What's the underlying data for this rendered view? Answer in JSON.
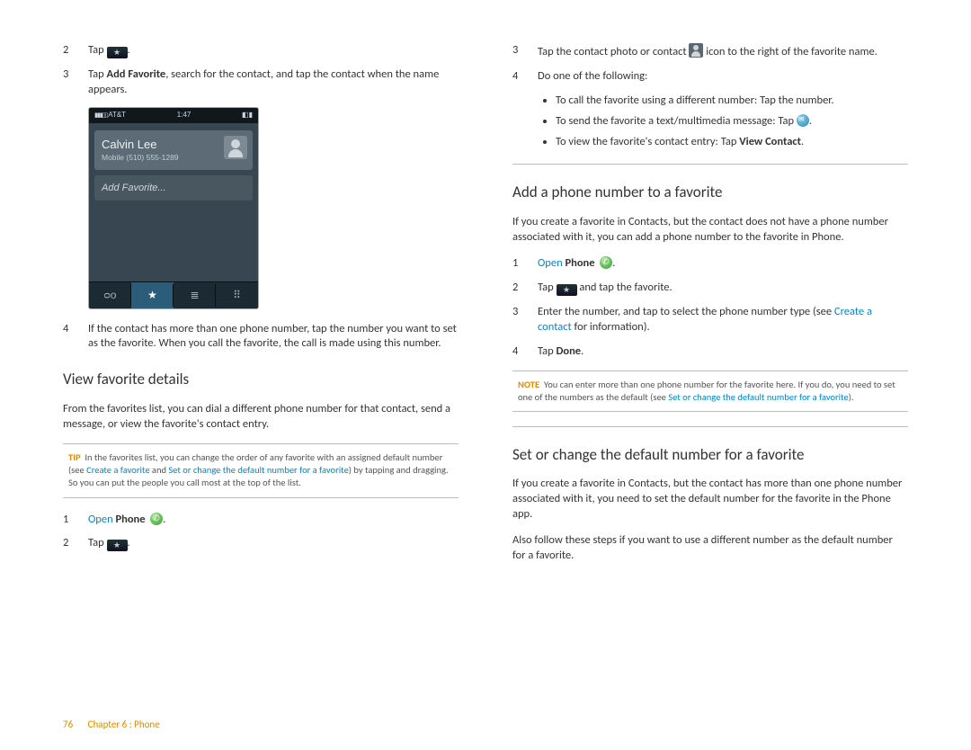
{
  "footer": {
    "page": "76",
    "chapter": "Chapter 6 : Phone"
  },
  "left": {
    "step2": {
      "n": "2",
      "text": "Tap "
    },
    "step3": {
      "n": "3",
      "pre": "Tap ",
      "bold": "Add Favorite",
      "post": ", search for the contact, and tap the contact when the name appears."
    },
    "screenshot": {
      "carrier": "AT&T",
      "time": "1:47",
      "name": "Calvin Lee",
      "sub": "Mobile (510) 555-1289",
      "add": "Add Favorite...",
      "tabs": {
        "vm": "⌕⌕",
        "star": "★",
        "list": "≣",
        "pad": "⠿"
      }
    },
    "step4": {
      "n": "4",
      "text": "If the contact has more than one phone number, tap the number you want to set as the favorite. When you call the favorite, the call is made using this number."
    },
    "h_view": "View favorite details",
    "view_intro": "From the favorites list, you can dial a different phone number for that contact, send a message, or view the favorite's contact entry.",
    "tip": {
      "tag": "TIP",
      "pre": "In the favorites list, you can change the order of any favorite with an assigned default number (see ",
      "link1": "Create a favorite",
      "mid": " and ",
      "link2": "Set or change the default number for a favorite",
      "post": ") by tapping and dragging. So you can put the people you call most at the top of the list."
    },
    "v1": {
      "n": "1",
      "open": "Open",
      "app": " Phone"
    },
    "v2": {
      "n": "2",
      "text": "Tap "
    }
  },
  "right": {
    "r3": {
      "n": "3",
      "pre": "Tap the contact photo or contact ",
      "post": " icon to the right of the favorite name."
    },
    "r4": {
      "n": "4",
      "text": "Do one of the following:"
    },
    "bullets": {
      "b1": "To call the favorite using a different number: Tap the number.",
      "b2": "To send the favorite a text/multimedia message: Tap ",
      "b3pre": "To view the favorite's contact entry: Tap ",
      "b3bold": "View Contact"
    },
    "h_add": "Add a phone number to a favorite",
    "add_intro": "If you create a favorite in Contacts, but the contact does not have a phone number associated with it, you can add a phone number to the favorite in Phone.",
    "a1": {
      "n": "1",
      "open": "Open",
      "app": " Phone"
    },
    "a2": {
      "n": "2",
      "pre": "Tap ",
      "post": " and tap the favorite."
    },
    "a3": {
      "n": "3",
      "pre": "Enter the number, and tap to select the phone number type (see ",
      "link": "Create a contact",
      "post": " for information)."
    },
    "a4": {
      "n": "4",
      "pre": "Tap ",
      "bold": "Done"
    },
    "note": {
      "tag": "NOTE",
      "pre": "You can enter more than one phone number for the favorite here. If you do, you need to set one of the numbers as the default (see ",
      "link": "Set or change the default number for a favorite",
      "post": ")."
    },
    "h_set": "Set or change the default number for a favorite",
    "set_p1": "If you create a favorite in Contacts, but the contact has more than one phone number associated with it, you need to set the default number for the favorite in the Phone app.",
    "set_p2": "Also follow these steps if you want to use a different number as the default number for a favorite."
  }
}
